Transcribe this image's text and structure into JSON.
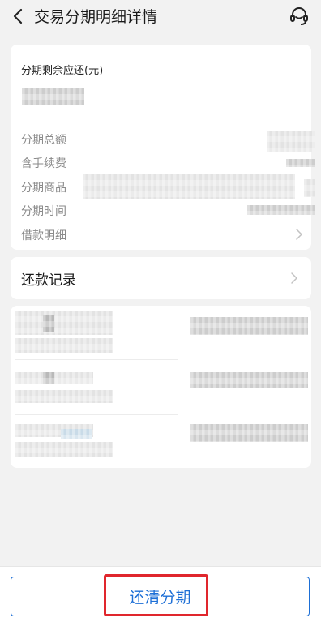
{
  "header": {
    "title": "交易分期明细详情",
    "back_icon": "chevron-left-icon",
    "service_icon": "headset-icon"
  },
  "summary": {
    "remaining_label": "分期剩余应还(元)",
    "rows": [
      {
        "label": "分期总额"
      },
      {
        "label": "含手续费"
      },
      {
        "label": "分期商品"
      },
      {
        "label": "分期时间"
      },
      {
        "label": "借款明细"
      }
    ]
  },
  "records": {
    "label": "还款记录"
  },
  "bottom": {
    "pay_off_label": "还清分期"
  },
  "colors": {
    "accent": "#1d6fd6",
    "highlight": "#e0262d"
  }
}
